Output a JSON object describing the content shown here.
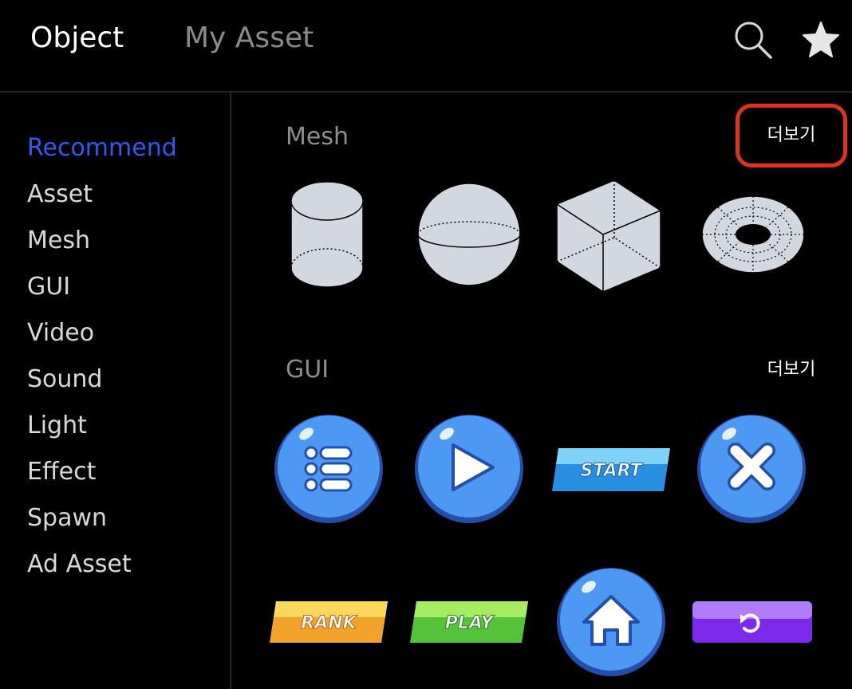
{
  "header": {
    "tabs": [
      {
        "label": "Object",
        "active": true
      },
      {
        "label": "My Asset",
        "active": false
      }
    ],
    "icons": [
      "search-icon",
      "star-icon"
    ]
  },
  "sidebar": {
    "items": [
      {
        "label": "Recommend",
        "active": true
      },
      {
        "label": "Asset"
      },
      {
        "label": "Mesh"
      },
      {
        "label": "GUI"
      },
      {
        "label": "Video"
      },
      {
        "label": "Sound"
      },
      {
        "label": "Light"
      },
      {
        "label": "Effect"
      },
      {
        "label": "Spawn"
      },
      {
        "label": "Ad Asset"
      }
    ],
    "active_color": "#2e5bf0"
  },
  "sections": {
    "mesh": {
      "title": "Mesh",
      "more_label": "더보기",
      "items": [
        "cylinder-icon",
        "sphere-icon",
        "cube-icon",
        "torus-icon"
      ]
    },
    "gui": {
      "title": "GUI",
      "more_label": "더보기",
      "items": [
        "list-icon",
        "play-icon",
        "start-button",
        "close-icon",
        "rank-button",
        "play-button",
        "home-icon",
        "refresh-icon"
      ],
      "start_label": "START",
      "rank_label": "RANK",
      "play_label": "PLAY"
    }
  },
  "colors": {
    "background": "#000000",
    "highlight": "#e0301e",
    "gui_blue": "#4d98f2",
    "mesh_fill": "#d3d7e0"
  }
}
